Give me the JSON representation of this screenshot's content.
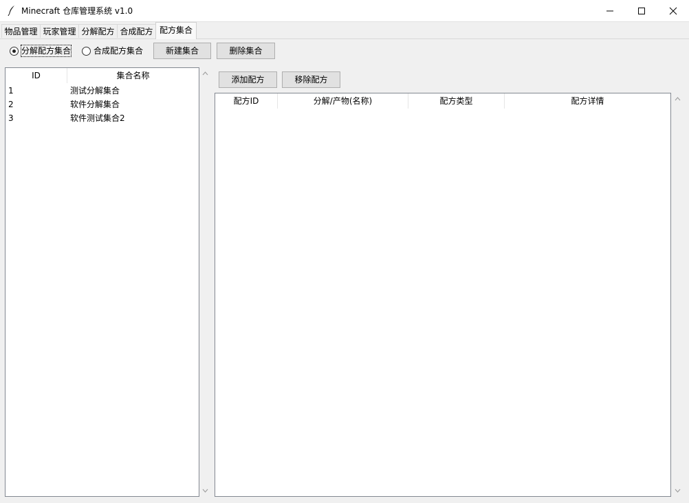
{
  "window": {
    "title": "Minecraft 仓库管理系统 v1.0",
    "icon": "feather-icon"
  },
  "tabs": [
    {
      "label": "物品管理",
      "active": false
    },
    {
      "label": "玩家管理",
      "active": false
    },
    {
      "label": "分解配方",
      "active": false
    },
    {
      "label": "合成配方",
      "active": false
    },
    {
      "label": "配方集合",
      "active": true
    }
  ],
  "set_type": {
    "options": [
      {
        "label": "分解配方集合",
        "selected": true
      },
      {
        "label": "合成配方集合",
        "selected": false
      }
    ]
  },
  "toolbar": {
    "new_set": "新建集合",
    "delete_set": "删除集合",
    "add_recipe": "添加配方",
    "remove_recipe": "移除配方"
  },
  "sets_table": {
    "columns": [
      "ID",
      "集合名称"
    ],
    "rows": [
      {
        "id": "1",
        "name": "测试分解集合"
      },
      {
        "id": "2",
        "name": "软件分解集合"
      },
      {
        "id": "3",
        "name": "软件测试集合2"
      }
    ]
  },
  "recipes_table": {
    "columns": [
      "配方ID",
      "分解/产物(名称)",
      "配方类型",
      "配方详情"
    ],
    "rows": []
  }
}
